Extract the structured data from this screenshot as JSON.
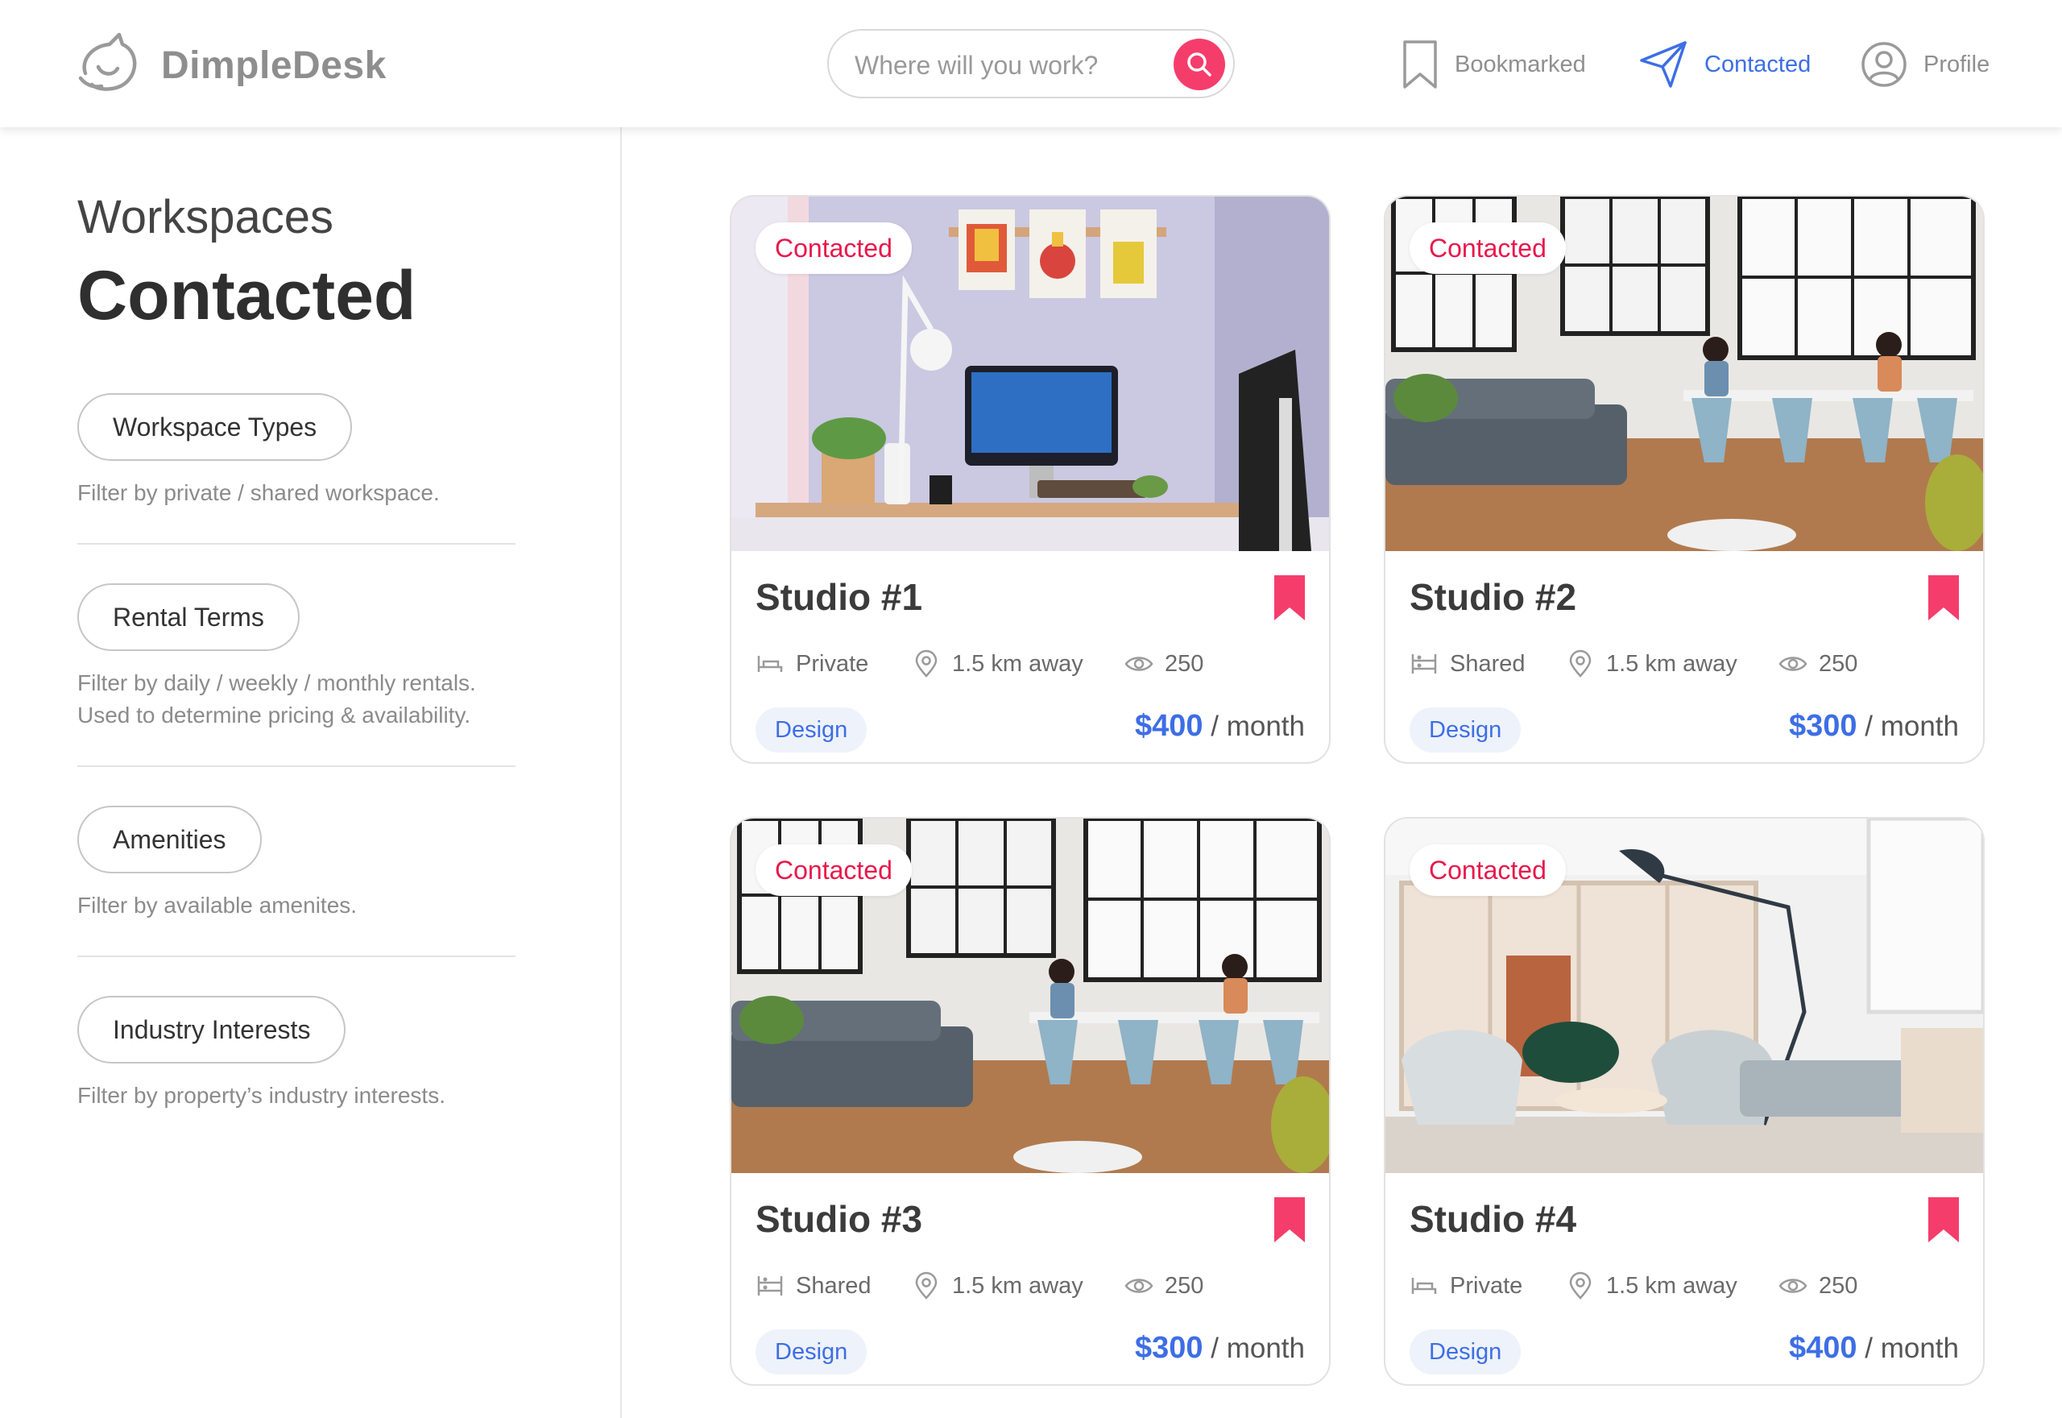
{
  "brand": {
    "name": "DimpleDesk"
  },
  "search": {
    "placeholder": "Where will you work?"
  },
  "nav": [
    {
      "label": "Bookmarked",
      "icon": "bookmark-outline-icon"
    },
    {
      "label": "Contacted",
      "icon": "paper-plane-icon",
      "active": true
    },
    {
      "label": "Profile",
      "icon": "user-circle-icon"
    }
  ],
  "sidebar": {
    "eyebrow": "Workspaces",
    "title": "Contacted",
    "filters": [
      {
        "label": "Workspace Types",
        "desc": "Filter by private / shared workspace."
      },
      {
        "label": "Rental Terms",
        "desc": "Filter by daily / weekly / monthly rentals.\nUsed to determine pricing & availability."
      },
      {
        "label": "Amenities",
        "desc": "Filter by available amenites."
      },
      {
        "label": "Industry Interests",
        "desc": "Filter by property’s industry interests."
      }
    ]
  },
  "cards": [
    {
      "status": "Contacted",
      "title": "Studio #1",
      "type": "Private",
      "distance": "1.5 km away",
      "views": "250",
      "tag": "Design",
      "price": "$400",
      "period": "/ month",
      "bookmarked": true
    },
    {
      "status": "Contacted",
      "title": "Studio #2",
      "type": "Shared",
      "distance": "1.5 km away",
      "views": "250",
      "tag": "Design",
      "price": "$300",
      "period": "/ month",
      "bookmarked": true
    },
    {
      "status": "Contacted",
      "title": "Studio #3",
      "type": "Shared",
      "distance": "1.5 km away",
      "views": "250",
      "tag": "Design",
      "price": "$300",
      "period": "/ month",
      "bookmarked": true
    },
    {
      "status": "Contacted",
      "title": "Studio #4",
      "type": "Private",
      "distance": "1.5 km away",
      "views": "250",
      "tag": "Design",
      "price": "$400",
      "period": "/ month",
      "bookmarked": true
    }
  ],
  "colors": {
    "accent_pink": "#f53d6c",
    "accent_blue": "#3d6ee6",
    "badge_red": "#e8184b"
  }
}
